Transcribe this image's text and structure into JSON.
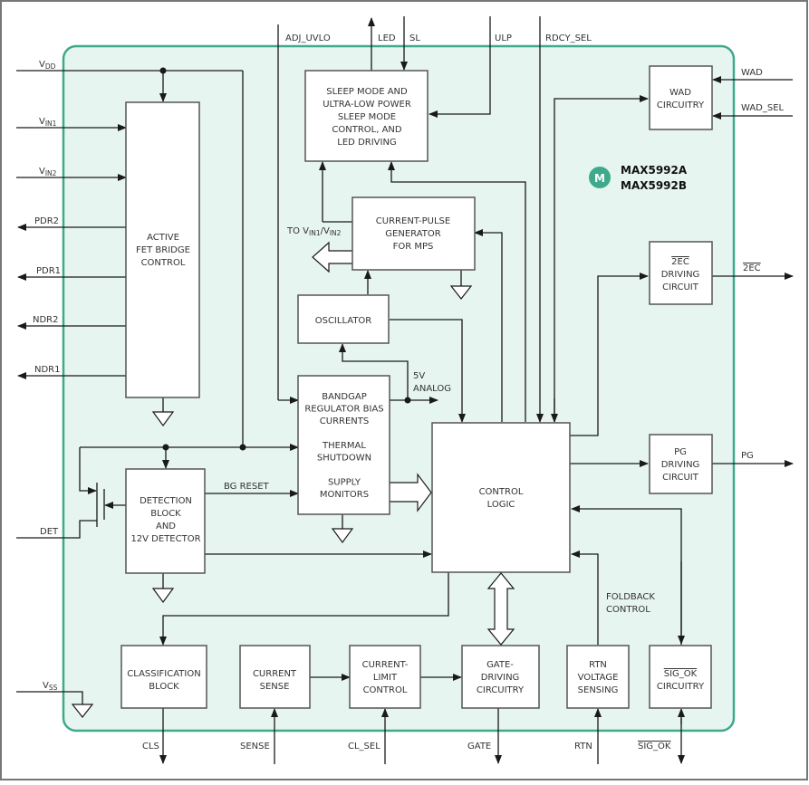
{
  "colors": {
    "chip_fill": "#e6f5f0",
    "chip_border": "#3fa98c",
    "line": "#1a1a1a",
    "block_fill": "#ffffff",
    "block_border": "#555555",
    "logo": "#3fa98c"
  },
  "title": {
    "line1": "MAX5992A",
    "line2": "MAX5992B",
    "logo_icon": "maxim-logo-icon",
    "logo_glyph": "M"
  },
  "blocks": {
    "active_fet": [
      "ACTIVE",
      "FET BRIDGE",
      "CONTROL"
    ],
    "sleep": [
      "SLEEP MODE AND",
      "ULTRA-LOW POWER",
      "SLEEP MODE",
      "CONTROL, AND",
      "LED DRIVING"
    ],
    "current_pulse": [
      "CURRENT-PULSE",
      "GENERATOR",
      "FOR MPS"
    ],
    "oscillator": [
      "OSCILLATOR"
    ],
    "bandgap": [
      "BANDGAP",
      "REGULATOR BIAS",
      "CURRENTS",
      "",
      "THERMAL",
      "SHUTDOWN",
      "",
      "SUPPLY",
      "MONITORS"
    ],
    "control_logic": [
      "CONTROL",
      "LOGIC"
    ],
    "detection": [
      "DETECTION",
      "BLOCK",
      "AND",
      "12V DETECTOR"
    ],
    "wad": [
      "WAD",
      "CIRCUITRY"
    ],
    "ec_driving": [
      "2EC",
      "DRIVING",
      "CIRCUIT"
    ],
    "pg_driving": [
      "PG",
      "DRIVING",
      "CIRCUIT"
    ],
    "classification": [
      "CLASSIFICATION",
      "BLOCK"
    ],
    "current_sense": [
      "CURRENT",
      "SENSE"
    ],
    "current_limit": [
      "CURRENT-",
      "LIMIT",
      "CONTROL"
    ],
    "gate_driving": [
      "GATE-",
      "DRIVING",
      "CIRCUITRY"
    ],
    "rtn_sensing": [
      "RTN",
      "VOLTAGE",
      "SENSING"
    ],
    "sig_ok": [
      "SIG_OK",
      "CIRCUITRY"
    ]
  },
  "pins": {
    "vdd": {
      "main": "V",
      "sub": "DD"
    },
    "vin1": {
      "main": "V",
      "sub": "IN1"
    },
    "vin2": {
      "main": "V",
      "sub": "IN2"
    },
    "pdr2": "PDR2",
    "pdr1": "PDR1",
    "ndr2": "NDR2",
    "ndr1": "NDR1",
    "det": "DET",
    "vss": {
      "main": "V",
      "sub": "SS"
    },
    "adj_uvlo": "ADJ_UVLO",
    "led": "LED",
    "sl": "SL",
    "ulp": "ULP",
    "rdcy_sel": "RDCY_SEL",
    "wad": "WAD",
    "wad_sel": "WAD_SEL",
    "ec": "2EC",
    "pg": "PG",
    "cls": "CLS",
    "sense": "SENSE",
    "cl_sel": "CL_SEL",
    "gate": "GATE",
    "rtn": "RTN",
    "sig_ok": "SIG_OK"
  },
  "annotations": {
    "to_vin": {
      "prefix": "TO V",
      "sub1": "IN1",
      "mid": "/V",
      "sub2": "IN2"
    },
    "five_v": [
      "5V",
      "ANALOG"
    ],
    "bg_reset": "BG RESET",
    "foldback": [
      "FOLDBACK",
      "CONTROL"
    ]
  }
}
